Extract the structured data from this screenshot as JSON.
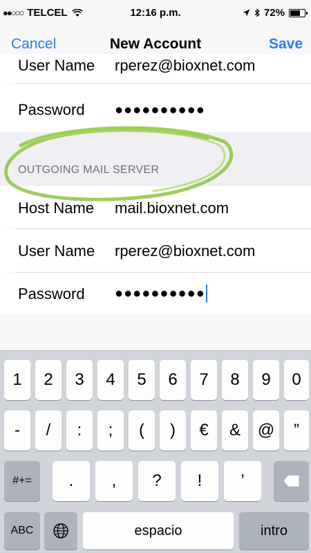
{
  "status_bar": {
    "carrier": "TELCEL",
    "time": "12:16 p.m.",
    "battery_percent": "72%",
    "battery_level": 0.72,
    "icons": [
      "signal-dots-icon",
      "wifi-icon",
      "location-arrow-icon",
      "bluetooth-icon",
      "battery-icon"
    ]
  },
  "nav": {
    "cancel_label": "Cancel",
    "title": "New Account",
    "save_label": "Save"
  },
  "incoming": {
    "user_name_label": "User Name",
    "user_name_value": "rperez@bioxnet.com",
    "password_label": "Password",
    "password_value": "●●●●●●●●●●"
  },
  "outgoing": {
    "header": "OUTGOING MAIL SERVER",
    "host_name_label": "Host Name",
    "host_name_value": "mail.bioxnet.com",
    "user_name_label": "User Name",
    "user_name_value": "rperez@bioxnet.com",
    "password_label": "Password",
    "password_value": "●●●●●●●●●●"
  },
  "keyboard": {
    "row1": [
      "1",
      "2",
      "3",
      "4",
      "5",
      "6",
      "7",
      "8",
      "9",
      "0"
    ],
    "row2": [
      "-",
      "/",
      ":",
      ";",
      "(",
      ")",
      "€",
      "&",
      "@",
      "”"
    ],
    "row3_shift": "#+=",
    "row3": [
      ".",
      ",",
      "?",
      "!",
      "’"
    ],
    "abc_label": "ABC",
    "space_label": "espacio",
    "enter_label": "intro"
  },
  "colors": {
    "accent": "#2f7de1",
    "highlight_circle": "#8cc63f"
  }
}
